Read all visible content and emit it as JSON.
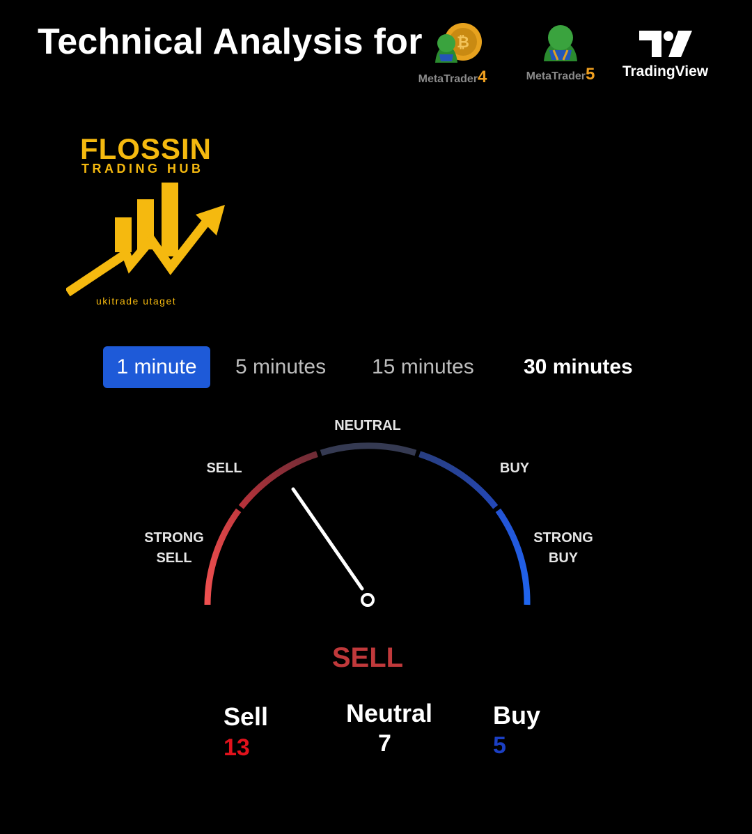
{
  "header": {
    "title": "Technical Analysis for",
    "platforms": [
      {
        "name": "MetaTrader",
        "version": "4"
      },
      {
        "name": "MetaTrader",
        "version": "5"
      },
      {
        "name": "TradingView"
      }
    ]
  },
  "brand": {
    "title": "FLOSSIN",
    "subtitle": "TRADING HUB",
    "tagline": "ukitrade utaget",
    "color": "#f5b90f"
  },
  "timeframes": {
    "tabs": [
      {
        "label": "1 minute",
        "active": true
      },
      {
        "label": "5 minutes",
        "active": false
      },
      {
        "label": "15 minutes",
        "active": false
      },
      {
        "label": "30 minutes",
        "active": false
      }
    ],
    "active_color": "#1e5ad8"
  },
  "gauge": {
    "labels": {
      "strong_sell": "STRONG\nSELL",
      "sell": "SELL",
      "neutral": "NEUTRAL",
      "buy": "BUY",
      "strong_buy": "STRONG\nBUY"
    },
    "verdict": "SELL",
    "needle_reading": "Sell",
    "colors": {
      "strong_sell": "#e5484d",
      "sell": "#a83038",
      "neutral": "#353a52",
      "buy": "#233f9a",
      "strong_buy": "#1f5ee8"
    }
  },
  "summary": {
    "sell": {
      "label": "Sell",
      "value": "13",
      "color": "#e1121c"
    },
    "neutral": {
      "label": "Neutral",
      "value": "7",
      "color": "#ffffff"
    },
    "buy": {
      "label": "Buy",
      "value": "5",
      "color": "#1b3fc4"
    }
  }
}
